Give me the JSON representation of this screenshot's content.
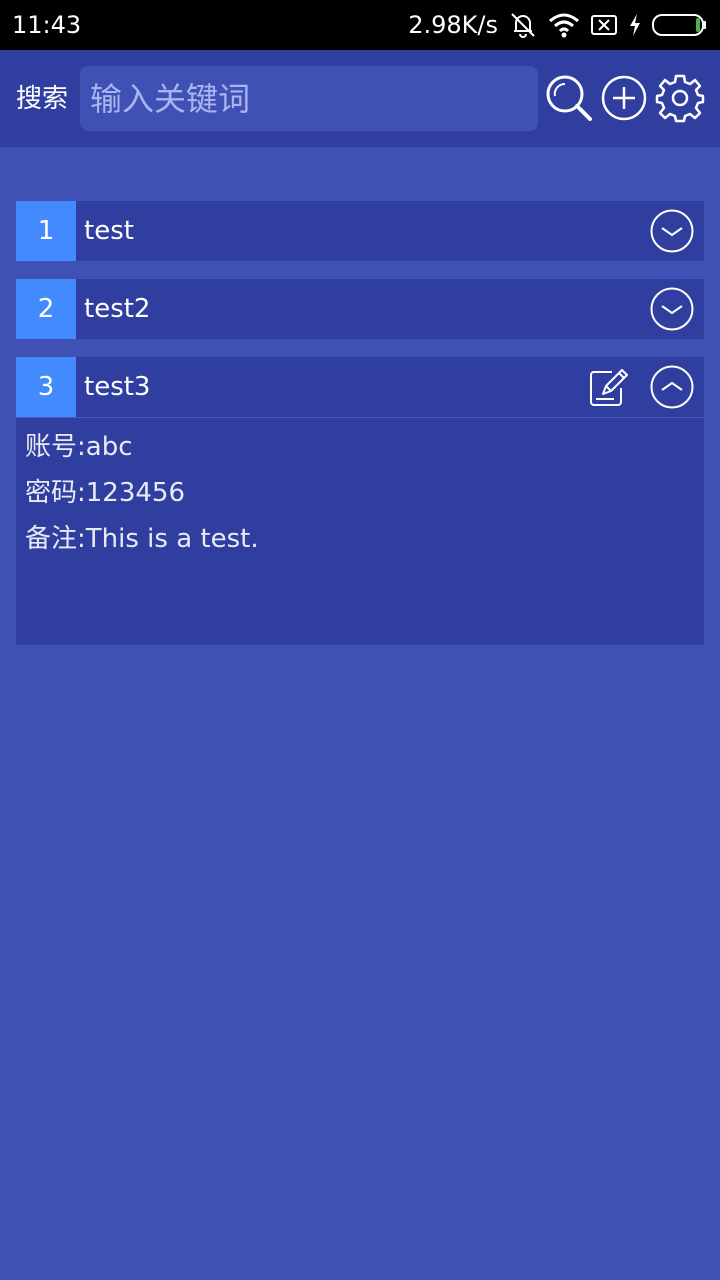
{
  "status_bar": {
    "time": "11:43",
    "net_speed": "2.98K/s",
    "icons": [
      "muted-bell-icon",
      "wifi-icon",
      "no-sim-icon",
      "charging-icon",
      "battery-icon"
    ]
  },
  "toolbar": {
    "search_label": "搜索",
    "search_placeholder": "输入关键词",
    "search_value": "",
    "icons": [
      "search-icon",
      "add-icon",
      "settings-icon"
    ]
  },
  "colors": {
    "background": "#3f51b5",
    "app_bar": "#303f9f",
    "index_badge": "#448aff"
  },
  "entries": [
    {
      "index": "1",
      "title": "test",
      "expanded": false
    },
    {
      "index": "2",
      "title": "test2",
      "expanded": false
    },
    {
      "index": "3",
      "title": "test3",
      "expanded": true,
      "account_line": "账号:abc",
      "password_line": "密码:123456",
      "note_line": "备注:This is a test."
    }
  ]
}
